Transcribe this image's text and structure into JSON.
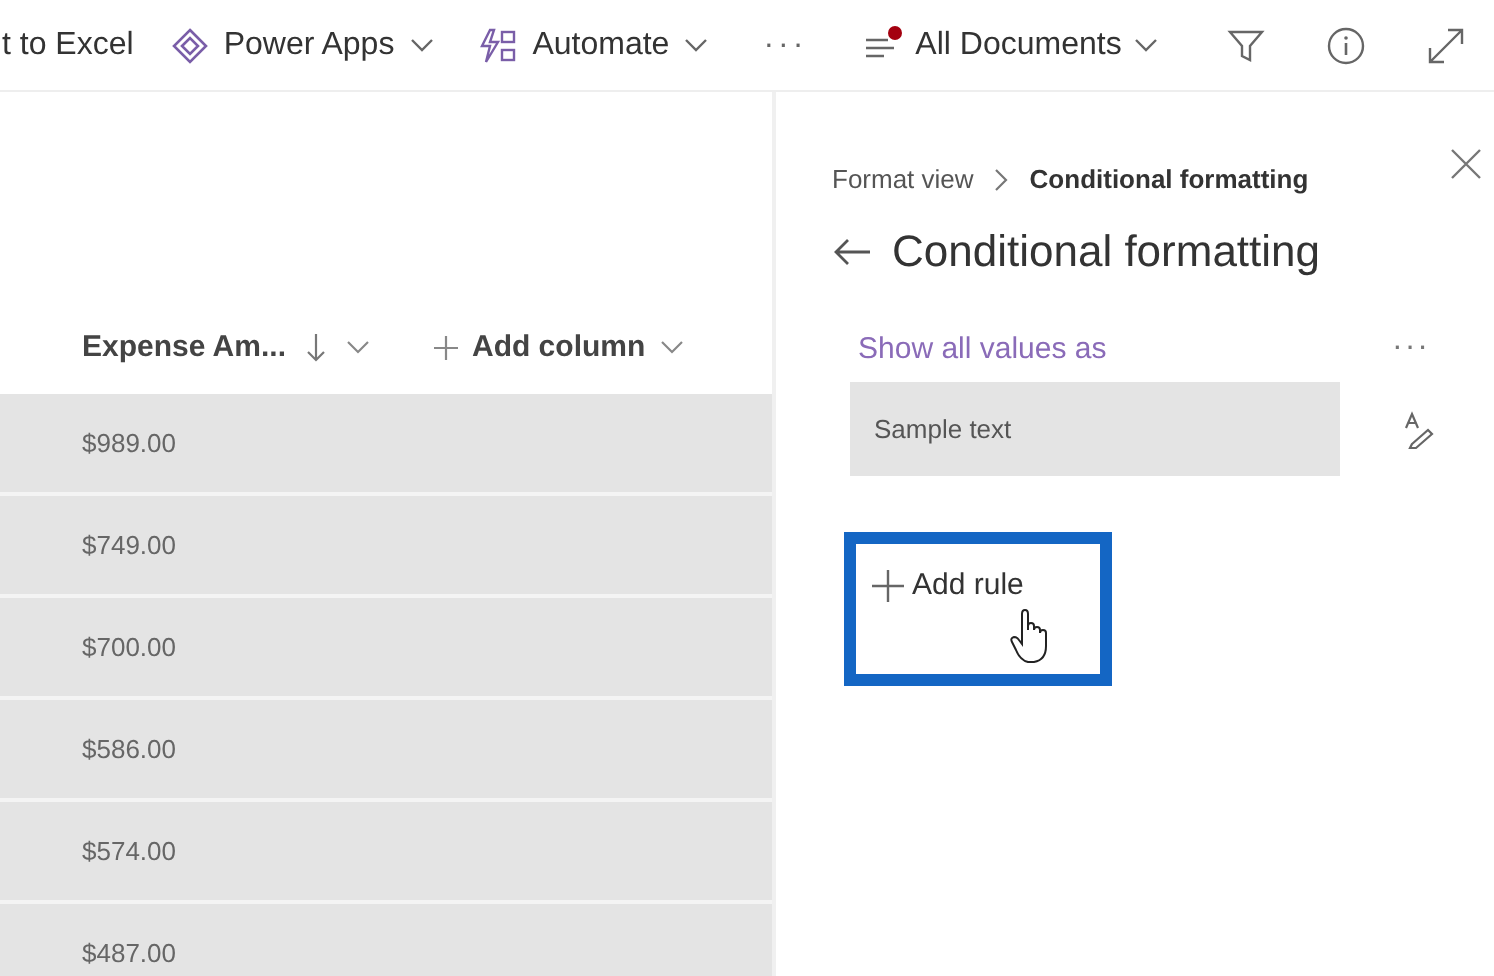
{
  "toolbar": {
    "export": "t to Excel",
    "power_apps": "Power Apps",
    "automate": "Automate",
    "more": "···",
    "view": {
      "label": "All Documents",
      "modified": true
    }
  },
  "list": {
    "column": {
      "label": "Expense Am...",
      "sorted_descending": true
    },
    "add_column": "Add column",
    "rows": [
      "$989.00",
      "$749.00",
      "$700.00",
      "$586.00",
      "$574.00",
      "$487.00"
    ]
  },
  "panel": {
    "breadcrumb": [
      "Format view",
      "Conditional formatting"
    ],
    "title": "Conditional formatting",
    "section_label": "Show all values as",
    "more": "···",
    "sample": "Sample text",
    "add_rule": "Add rule",
    "add_rule_highlighted": true
  }
}
